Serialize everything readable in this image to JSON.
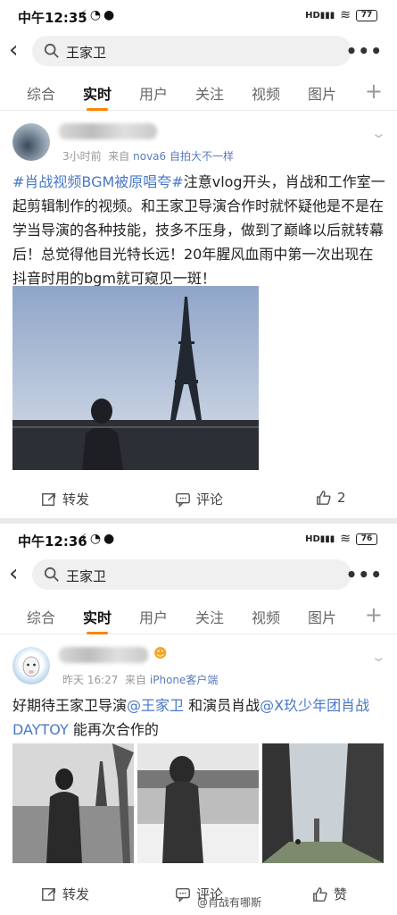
{
  "screen1": {
    "status": {
      "time": "中午12:35",
      "battery": "77"
    },
    "search": {
      "query": "王家卫"
    },
    "tabs": [
      "综合",
      "实时",
      "用户",
      "关注",
      "视频",
      "图片"
    ],
    "post": {
      "meta_time": "3小时前",
      "meta_from": "来自",
      "meta_source": "nova6 自拍大不一样",
      "hashtag": "#肖战视频BGM被原唱夸#",
      "text": "注意vlog开头，肖战和工作室一起剪辑制作的视频。和王家卫导演合作时就怀疑他是不是在学当导演的各种技能，技多不压身，做到了巅峰以后就转幕后！总觉得他目光特长远！20年腥风血雨中第一次出现在抖音时用的bgm就可窥见一斑！",
      "actions": {
        "repost": "转发",
        "comment": "评论",
        "like": "2"
      }
    }
  },
  "screen2": {
    "status": {
      "time": "中午12:36",
      "battery": "76"
    },
    "search": {
      "query": "王家卫"
    },
    "tabs": [
      "综合",
      "实时",
      "用户",
      "关注",
      "视频",
      "图片"
    ],
    "post": {
      "meta_time": "昨天 16:27",
      "meta_from": "来自",
      "meta_source": "iPhone客户端",
      "text_a": "好期待王家卫导演",
      "mention1": "@王家卫",
      "text_b": " 和演员肖战",
      "mention2": "@X玖少年团肖战DAYTOY",
      "text_c": " 能再次合作的",
      "actions": {
        "repost": "转发",
        "comment": "评论",
        "like": "赞"
      }
    },
    "watermark": "@肖战有哪斯"
  }
}
